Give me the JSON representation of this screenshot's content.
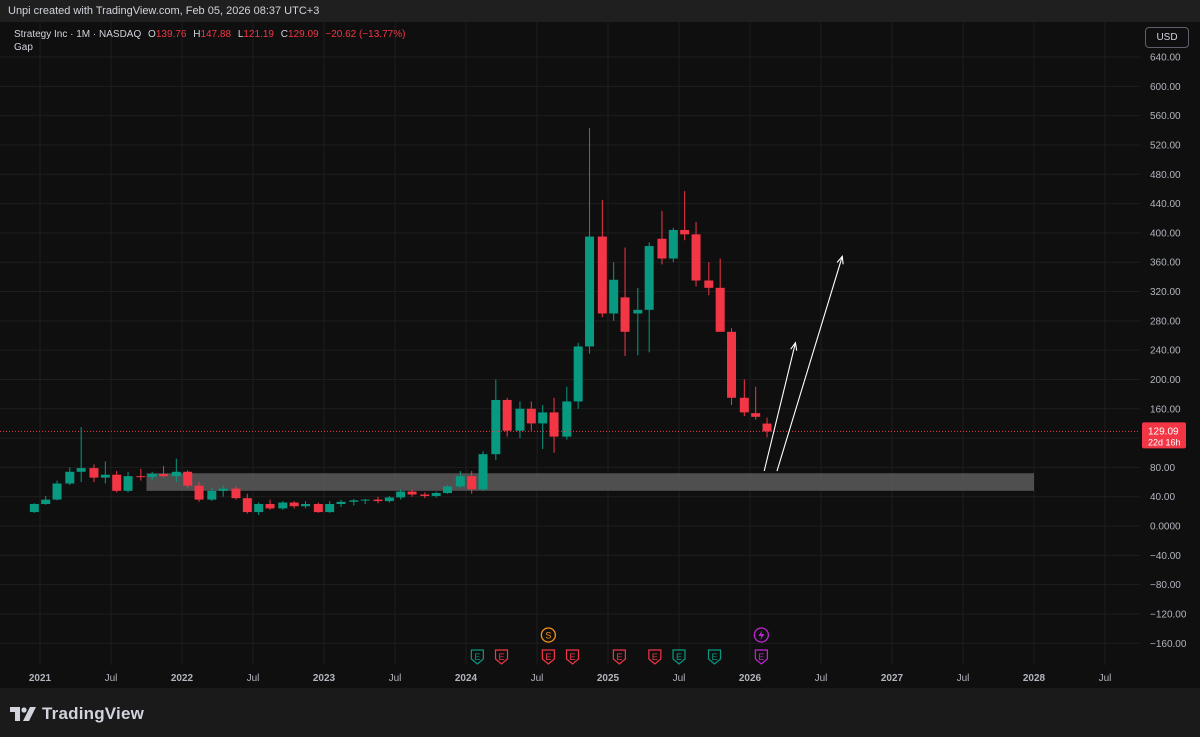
{
  "header": {
    "attribution": "Unpi created with TradingView.com, Feb 05, 2026 08:37 UTC+3"
  },
  "legend": {
    "symbol": "Strategy Inc · 1M · NASDAQ",
    "o_label": "O",
    "o_value": "139.76",
    "h_label": "H",
    "h_value": "147.88",
    "l_label": "L",
    "l_value": "121.19",
    "c_label": "C",
    "c_value": "129.09",
    "change": "−20.62 (−13.77%)",
    "indicator": "Gap"
  },
  "toolbar": {
    "currency_label": "USD"
  },
  "footer": {
    "brand": "TradingView"
  },
  "colors": {
    "up": "#089981",
    "down": "#f23645",
    "background": "#0f0f0f",
    "gap_zone": "#5a5a5a"
  },
  "chart_data": {
    "type": "candlestick",
    "symbol": "Strategy Inc",
    "interval": "1M",
    "exchange": "NASDAQ",
    "currency": "USD",
    "y_ticks": [
      "640.00",
      "600.00",
      "560.00",
      "520.00",
      "480.00",
      "440.00",
      "400.00",
      "360.00",
      "320.00",
      "280.00",
      "240.00",
      "200.00",
      "160.00",
      "120.00",
      "80.00",
      "40.00",
      "0.0000",
      "−40.00",
      "−80.00",
      "−120.00",
      "−160.00"
    ],
    "x_ticks": [
      {
        "label": "2021",
        "t": 2021.0,
        "bold": true
      },
      {
        "label": "Jul",
        "t": 2021.5,
        "bold": false
      },
      {
        "label": "2022",
        "t": 2022.0,
        "bold": true
      },
      {
        "label": "Jul",
        "t": 2022.5,
        "bold": false
      },
      {
        "label": "2023",
        "t": 2023.0,
        "bold": true
      },
      {
        "label": "Jul",
        "t": 2023.5,
        "bold": false
      },
      {
        "label": "2024",
        "t": 2024.0,
        "bold": true
      },
      {
        "label": "Jul",
        "t": 2024.5,
        "bold": false
      },
      {
        "label": "2025",
        "t": 2025.0,
        "bold": true
      },
      {
        "label": "Jul",
        "t": 2025.5,
        "bold": false
      },
      {
        "label": "2026",
        "t": 2026.0,
        "bold": true
      },
      {
        "label": "Jul",
        "t": 2026.5,
        "bold": false
      },
      {
        "label": "2027",
        "t": 2027.0,
        "bold": true
      },
      {
        "label": "Jul",
        "t": 2027.5,
        "bold": false
      },
      {
        "label": "2028",
        "t": 2028.0,
        "bold": true
      },
      {
        "label": "Jul",
        "t": 2028.5,
        "bold": false
      }
    ],
    "last_price": {
      "value": 129.09,
      "label": "129.09",
      "countdown": "22d 16h"
    },
    "gap_zone": {
      "from": 2021.75,
      "to": 2028.0,
      "low": 48,
      "high": 72
    },
    "projection_arrows": [
      {
        "from": [
          2026.1,
          75
        ],
        "to": [
          2026.32,
          250
        ]
      },
      {
        "from": [
          2026.19,
          75
        ],
        "to": [
          2026.65,
          368
        ]
      }
    ],
    "events": [
      {
        "t": 2024.08,
        "type": "E",
        "color": "#089981",
        "row": "bottom"
      },
      {
        "t": 2024.25,
        "type": "E",
        "color": "#f23645",
        "row": "bottom"
      },
      {
        "t": 2024.58,
        "type": "E",
        "color": "#f23645",
        "row": "bottom"
      },
      {
        "t": 2024.75,
        "type": "E",
        "color": "#f23645",
        "row": "bottom"
      },
      {
        "t": 2025.08,
        "type": "E",
        "color": "#f23645",
        "row": "bottom"
      },
      {
        "t": 2025.33,
        "type": "E",
        "color": "#f23645",
        "row": "bottom"
      },
      {
        "t": 2025.5,
        "type": "E",
        "color": "#089981",
        "row": "bottom"
      },
      {
        "t": 2025.75,
        "type": "E",
        "color": "#089981",
        "row": "bottom"
      },
      {
        "t": 2026.08,
        "type": "E",
        "color": "#c026d3",
        "row": "bottom"
      },
      {
        "t": 2024.58,
        "type": "S",
        "color": "#f7931a",
        "row": "top"
      },
      {
        "t": 2026.08,
        "type": "spark",
        "color": "#c026d3",
        "row": "top"
      }
    ],
    "candles": [
      {
        "t": 2020.96,
        "o": 19,
        "h": 31,
        "l": 18,
        "c": 30
      },
      {
        "t": 2021.04,
        "o": 30,
        "h": 41,
        "l": 29,
        "c": 36
      },
      {
        "t": 2021.12,
        "o": 36,
        "h": 62,
        "l": 35,
        "c": 58
      },
      {
        "t": 2021.21,
        "o": 58,
        "h": 80,
        "l": 56,
        "c": 74
      },
      {
        "t": 2021.29,
        "o": 74,
        "h": 135,
        "l": 60,
        "c": 79
      },
      {
        "t": 2021.38,
        "o": 79,
        "h": 84,
        "l": 60,
        "c": 66
      },
      {
        "t": 2021.46,
        "o": 66,
        "h": 88,
        "l": 58,
        "c": 70
      },
      {
        "t": 2021.54,
        "o": 70,
        "h": 75,
        "l": 46,
        "c": 48
      },
      {
        "t": 2021.62,
        "o": 48,
        "h": 74,
        "l": 46,
        "c": 68
      },
      {
        "t": 2021.71,
        "o": 68,
        "h": 78,
        "l": 62,
        "c": 67
      },
      {
        "t": 2021.79,
        "o": 67,
        "h": 74,
        "l": 62,
        "c": 71
      },
      {
        "t": 2021.87,
        "o": 71,
        "h": 82,
        "l": 66,
        "c": 68
      },
      {
        "t": 2021.96,
        "o": 68,
        "h": 92,
        "l": 60,
        "c": 74
      },
      {
        "t": 2022.04,
        "o": 74,
        "h": 76,
        "l": 52,
        "c": 55
      },
      {
        "t": 2022.12,
        "o": 55,
        "h": 60,
        "l": 33,
        "c": 36
      },
      {
        "t": 2022.21,
        "o": 36,
        "h": 52,
        "l": 34,
        "c": 48
      },
      {
        "t": 2022.29,
        "o": 48,
        "h": 55,
        "l": 40,
        "c": 51
      },
      {
        "t": 2022.38,
        "o": 51,
        "h": 54,
        "l": 36,
        "c": 38
      },
      {
        "t": 2022.46,
        "o": 38,
        "h": 44,
        "l": 17,
        "c": 19
      },
      {
        "t": 2022.54,
        "o": 19,
        "h": 32,
        "l": 15,
        "c": 30
      },
      {
        "t": 2022.62,
        "o": 30,
        "h": 36,
        "l": 22,
        "c": 24
      },
      {
        "t": 2022.71,
        "o": 24,
        "h": 34,
        "l": 22,
        "c": 32
      },
      {
        "t": 2022.79,
        "o": 32,
        "h": 34,
        "l": 24,
        "c": 27
      },
      {
        "t": 2022.87,
        "o": 27,
        "h": 34,
        "l": 24,
        "c": 30
      },
      {
        "t": 2022.96,
        "o": 30,
        "h": 32,
        "l": 18,
        "c": 19
      },
      {
        "t": 2023.04,
        "o": 19,
        "h": 34,
        "l": 18,
        "c": 30
      },
      {
        "t": 2023.12,
        "o": 30,
        "h": 36,
        "l": 26,
        "c": 33
      },
      {
        "t": 2023.21,
        "o": 33,
        "h": 37,
        "l": 28,
        "c": 35
      },
      {
        "t": 2023.29,
        "o": 35,
        "h": 37,
        "l": 30,
        "c": 36
      },
      {
        "t": 2023.38,
        "o": 36,
        "h": 40,
        "l": 31,
        "c": 34
      },
      {
        "t": 2023.46,
        "o": 34,
        "h": 41,
        "l": 32,
        "c": 39
      },
      {
        "t": 2023.54,
        "o": 39,
        "h": 50,
        "l": 36,
        "c": 47
      },
      {
        "t": 2023.62,
        "o": 47,
        "h": 50,
        "l": 40,
        "c": 43
      },
      {
        "t": 2023.71,
        "o": 43,
        "h": 46,
        "l": 38,
        "c": 41
      },
      {
        "t": 2023.79,
        "o": 41,
        "h": 47,
        "l": 39,
        "c": 45
      },
      {
        "t": 2023.87,
        "o": 45,
        "h": 56,
        "l": 44,
        "c": 54
      },
      {
        "t": 2023.96,
        "o": 54,
        "h": 75,
        "l": 52,
        "c": 68
      },
      {
        "t": 2024.04,
        "o": 68,
        "h": 75,
        "l": 44,
        "c": 50
      },
      {
        "t": 2024.12,
        "o": 50,
        "h": 102,
        "l": 48,
        "c": 98
      },
      {
        "t": 2024.21,
        "o": 98,
        "h": 200,
        "l": 90,
        "c": 172
      },
      {
        "t": 2024.29,
        "o": 172,
        "h": 175,
        "l": 122,
        "c": 130
      },
      {
        "t": 2024.38,
        "o": 130,
        "h": 170,
        "l": 120,
        "c": 160
      },
      {
        "t": 2024.46,
        "o": 160,
        "h": 170,
        "l": 130,
        "c": 140
      },
      {
        "t": 2024.54,
        "o": 140,
        "h": 165,
        "l": 105,
        "c": 155
      },
      {
        "t": 2024.62,
        "o": 155,
        "h": 175,
        "l": 100,
        "c": 122
      },
      {
        "t": 2024.71,
        "o": 122,
        "h": 190,
        "l": 118,
        "c": 170
      },
      {
        "t": 2024.79,
        "o": 170,
        "h": 250,
        "l": 160,
        "c": 245
      },
      {
        "t": 2024.87,
        "o": 245,
        "h": 543,
        "l": 235,
        "c": 395
      },
      {
        "t": 2024.96,
        "o": 395,
        "h": 445,
        "l": 285,
        "c": 290
      },
      {
        "t": 2025.04,
        "o": 290,
        "h": 360,
        "l": 280,
        "c": 336
      },
      {
        "t": 2025.12,
        "o": 312,
        "h": 380,
        "l": 232,
        "c": 265
      },
      {
        "t": 2025.21,
        "o": 290,
        "h": 325,
        "l": 233,
        "c": 295
      },
      {
        "t": 2025.29,
        "o": 295,
        "h": 387,
        "l": 237,
        "c": 382
      },
      {
        "t": 2025.38,
        "o": 392,
        "h": 430,
        "l": 357,
        "c": 365
      },
      {
        "t": 2025.46,
        "o": 365,
        "h": 407,
        "l": 360,
        "c": 404
      },
      {
        "t": 2025.54,
        "o": 404,
        "h": 457,
        "l": 390,
        "c": 398
      },
      {
        "t": 2025.62,
        "o": 398,
        "h": 415,
        "l": 327,
        "c": 335
      },
      {
        "t": 2025.71,
        "o": 335,
        "h": 360,
        "l": 315,
        "c": 325
      },
      {
        "t": 2025.79,
        "o": 325,
        "h": 365,
        "l": 265,
        "c": 265
      },
      {
        "t": 2025.87,
        "o": 265,
        "h": 270,
        "l": 165,
        "c": 175
      },
      {
        "t": 2025.96,
        "o": 175,
        "h": 200,
        "l": 150,
        "c": 155
      },
      {
        "t": 2026.04,
        "o": 154,
        "h": 190,
        "l": 145,
        "c": 149
      },
      {
        "t": 2026.12,
        "o": 139.76,
        "h": 147.88,
        "l": 121.19,
        "c": 129.09
      }
    ]
  }
}
